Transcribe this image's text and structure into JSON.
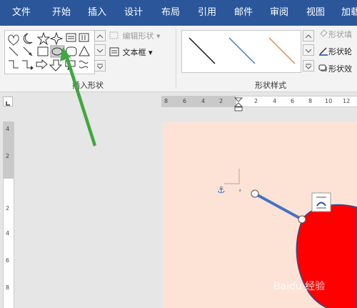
{
  "tabs": [
    "文件",
    "开始",
    "插入",
    "设计",
    "布局",
    "引用",
    "邮件",
    "审阅",
    "视图",
    "加载"
  ],
  "ribbon": {
    "edit_shape": "编辑形状",
    "text_box": "文本框",
    "insert_shapes_group": "插入形状",
    "shape_styles_group": "形状样式",
    "shape_fill": "形状填",
    "shape_outline": "形状轮",
    "shape_effects": "形状效"
  },
  "ruler": {
    "h_numbers": [
      "8",
      "6",
      "4",
      "2",
      "2",
      "4",
      "6",
      "8",
      "10",
      "12"
    ],
    "v_numbers": [
      "4",
      "2",
      "2",
      "4",
      "6",
      "8"
    ]
  },
  "style_colors": [
    "#1a1a1a",
    "#3f7fc5",
    "#e08a4b"
  ],
  "shape_fill_color": "#ff0000",
  "connector_color": "#4472c4",
  "arrow_color": "#3fa83f",
  "watermark": "Baidu 经验"
}
